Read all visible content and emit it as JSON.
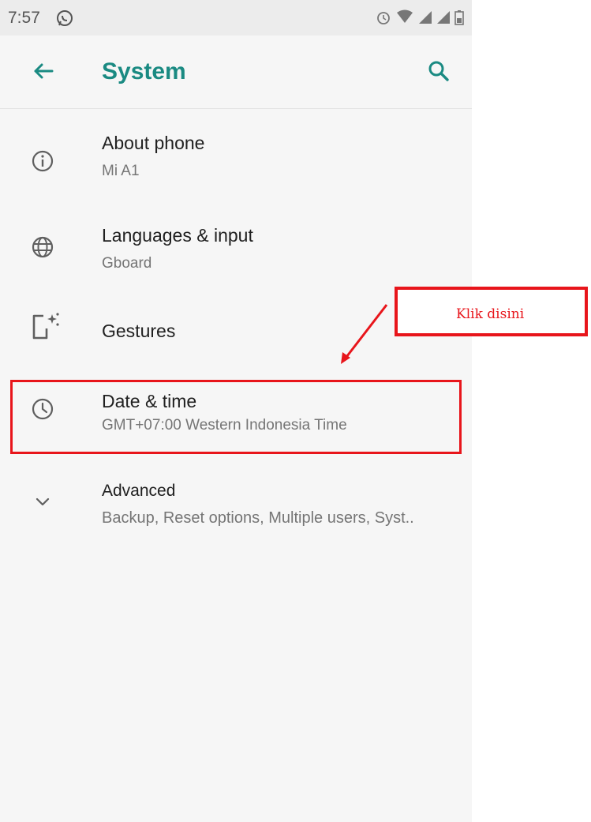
{
  "status_bar": {
    "time": "7:57"
  },
  "app_bar": {
    "title": "System"
  },
  "settings": [
    {
      "title": "About phone",
      "subtitle": "Mi A1",
      "icon": "info-icon"
    },
    {
      "title": "Languages & input",
      "subtitle": "Gboard",
      "icon": "globe-icon"
    },
    {
      "title": "Gestures",
      "icon": "gestures-icon"
    },
    {
      "title": "Date & time",
      "subtitle": "GMT+07:00 Western Indonesia Time",
      "icon": "clock-icon"
    },
    {
      "title": "Advanced",
      "subtitle": "Backup, Reset options, Multiple users, Syst..",
      "icon": "chevron-down-icon"
    }
  ],
  "annotation": {
    "text": "Klik disini",
    "color": "#e8151b"
  },
  "colors": {
    "accent": "#1a8a82",
    "background": "#f6f6f6",
    "highlight": "#e8151b"
  }
}
